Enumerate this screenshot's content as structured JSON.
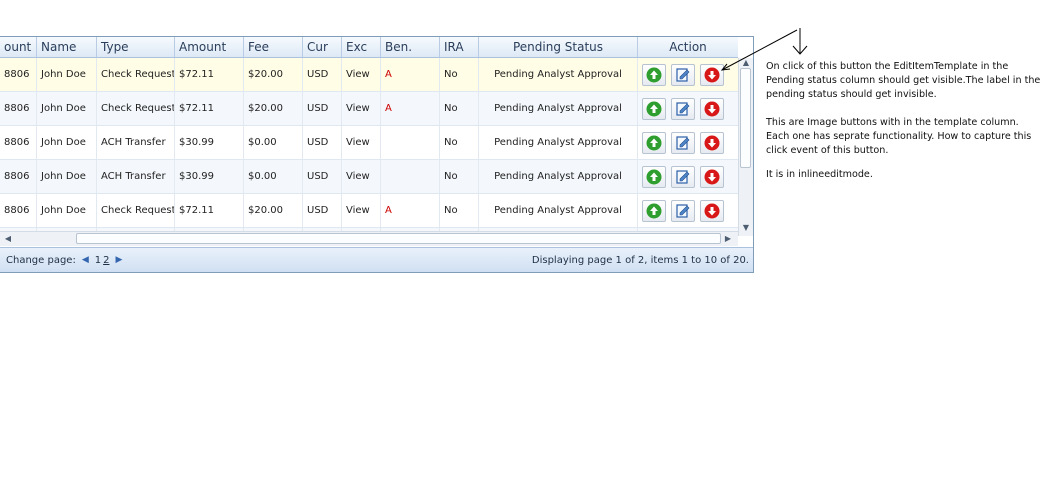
{
  "grid": {
    "columns": [
      "ount",
      "Name",
      "Type",
      "Amount",
      "Fee",
      "Cur",
      "Exc",
      "Ben.",
      "IRA",
      "Pending Status",
      "Action"
    ],
    "rows": [
      {
        "acct": "8806",
        "name": "John Doe",
        "type": "Check Request",
        "amount": "$72.11",
        "fee": "$20.00",
        "cur": "USD",
        "exc": "View",
        "ben": "A",
        "ira": "No",
        "status": "Pending Analyst Approval"
      },
      {
        "acct": "8806",
        "name": "John Doe",
        "type": "Check Request",
        "amount": "$72.11",
        "fee": "$20.00",
        "cur": "USD",
        "exc": "View",
        "ben": "A",
        "ira": "No",
        "status": "Pending Analyst Approval"
      },
      {
        "acct": "8806",
        "name": "John Doe",
        "type": "ACH Transfer",
        "amount": "$30.99",
        "fee": "$0.00",
        "cur": "USD",
        "exc": "View",
        "ben": "",
        "ira": "No",
        "status": "Pending Analyst Approval"
      },
      {
        "acct": "8806",
        "name": "John Doe",
        "type": "ACH Transfer",
        "amount": "$30.99",
        "fee": "$0.00",
        "cur": "USD",
        "exc": "View",
        "ben": "",
        "ira": "No",
        "status": "Pending Analyst Approval"
      },
      {
        "acct": "8806",
        "name": "John Doe",
        "type": "Check Request",
        "amount": "$72.11",
        "fee": "$20.00",
        "cur": "USD",
        "exc": "View",
        "ben": "A",
        "ira": "No",
        "status": "Pending Analyst Approval"
      },
      {
        "acct": "",
        "name": "",
        "type": "",
        "amount": "",
        "fee": "",
        "cur": "",
        "exc": "",
        "ben": "",
        "ira": "",
        "status": ""
      }
    ],
    "action_icons": [
      "approve-up-arrow-icon",
      "edit-document-icon",
      "reject-down-arrow-icon"
    ]
  },
  "pager": {
    "change_page_label": "Change page:",
    "pages": [
      "1",
      "2"
    ],
    "current_page": "2",
    "status": "Displaying page 1 of 2, items 1 to 10 of 20."
  },
  "annotations": {
    "note1": "On click of this button the EditItemTemplate in the Pending status column should get visible.The label in the pending status should get invisible.",
    "note2": "This are Image buttons with in the template column. Each one has seprate functionality. How to capture this click event of this button.",
    "note3": "It is in inlineeditmode."
  },
  "colors": {
    "approve": "#2e9e2e",
    "reject": "#d81818",
    "selected_row": "#fffde6",
    "header_text": "#2a3e5a"
  }
}
